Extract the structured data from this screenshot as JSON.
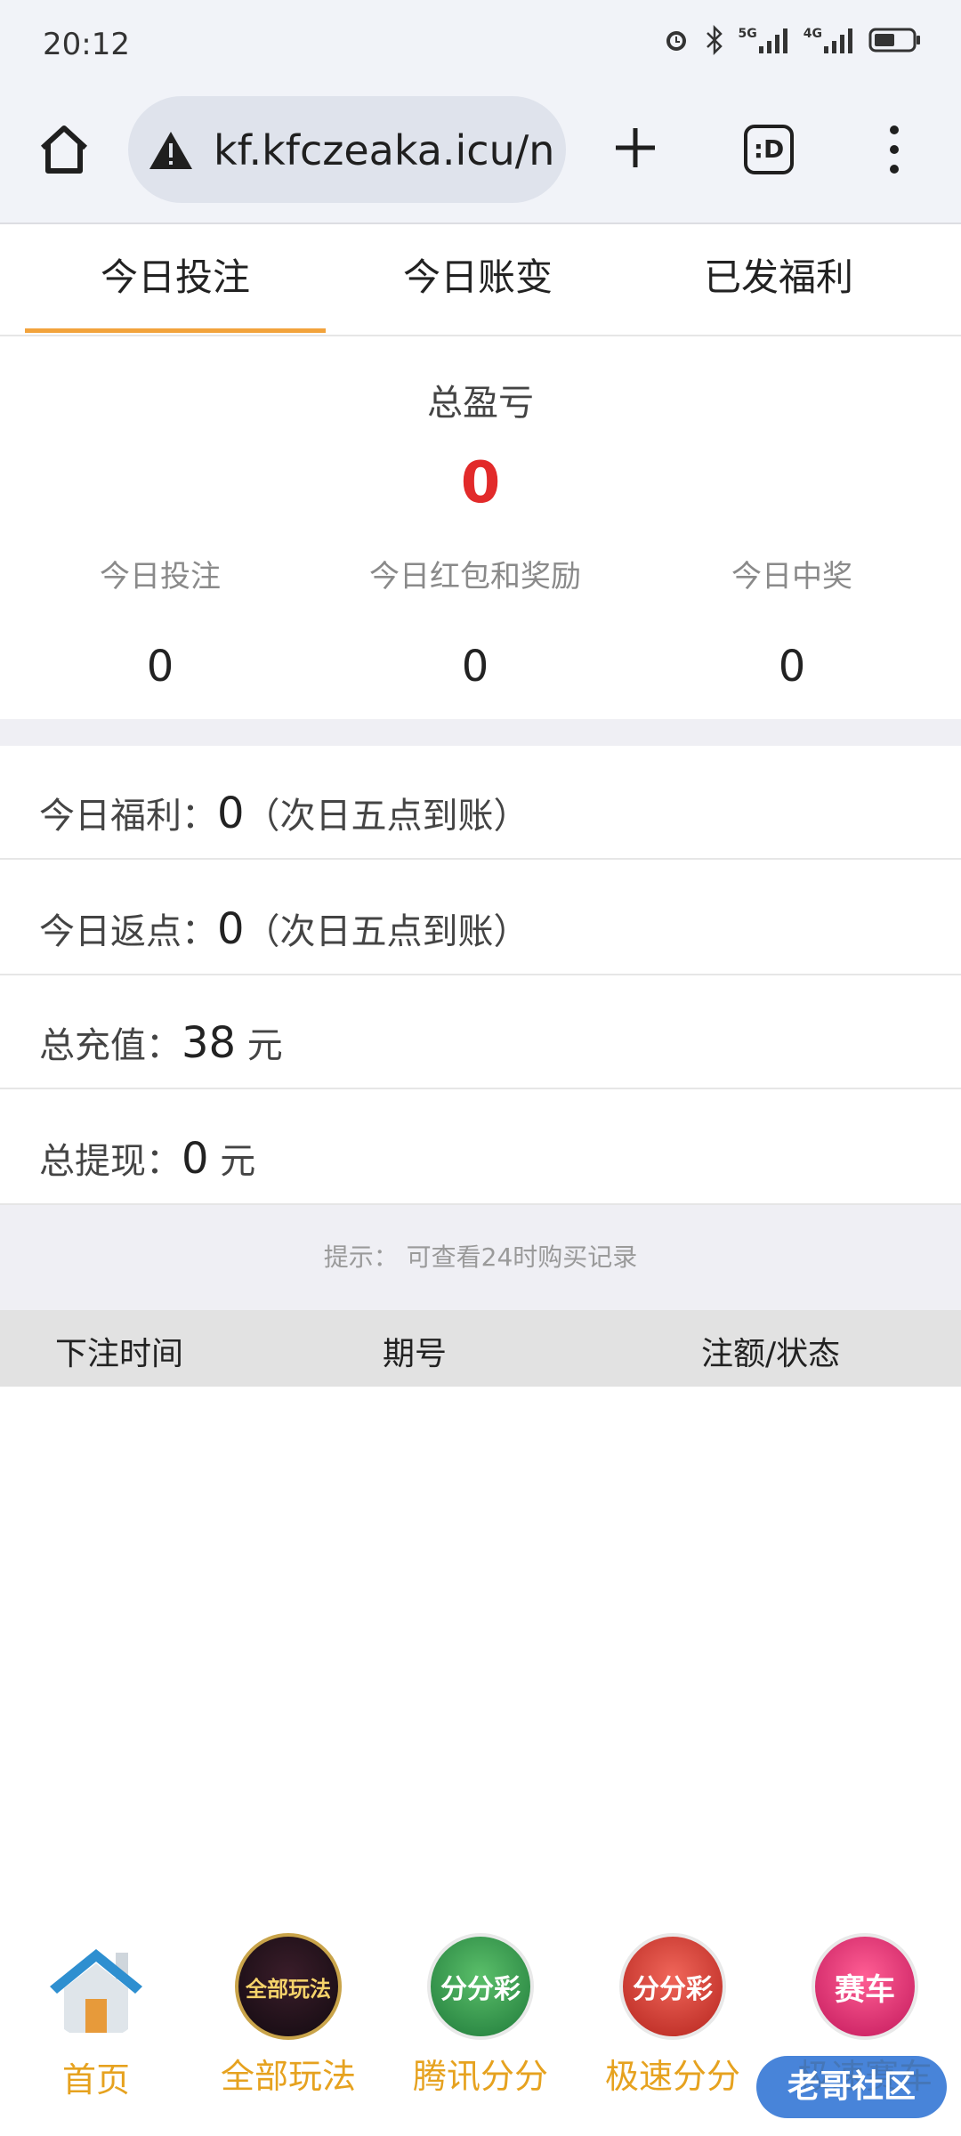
{
  "status_bar": {
    "time": "20:12",
    "icons": [
      "alarm-icon",
      "bluetooth-icon",
      "signal-5g-icon",
      "signal-4g-icon",
      "battery-icon"
    ],
    "net1": "5G",
    "net2": "4G"
  },
  "browser": {
    "url": "kf.kfczeaka.icu/n",
    "tabs_label": ":D"
  },
  "tabs": [
    {
      "label": "今日投注",
      "active": true
    },
    {
      "label": "今日账变",
      "active": false
    },
    {
      "label": "已发福利",
      "active": false
    }
  ],
  "summary": {
    "title": "总盈亏",
    "total": "0",
    "stats": [
      {
        "label": "今日投注",
        "value": "0"
      },
      {
        "label": "今日红包和奖励",
        "value": "0"
      },
      {
        "label": "今日中奖",
        "value": "0"
      }
    ]
  },
  "rows": [
    {
      "label": "今日福利：",
      "value": "0",
      "suffix": "（次日五点到账）"
    },
    {
      "label": "今日返点：",
      "value": "0",
      "suffix": "（次日五点到账）"
    },
    {
      "label": "总充值：",
      "value": "38",
      "suffix": " 元"
    },
    {
      "label": "总提现：",
      "value": "0",
      "suffix": " 元"
    }
  ],
  "hint": "提示： 可查看24时购买记录",
  "table_headers": [
    "下注时间",
    "期号",
    "注额/状态"
  ],
  "bottom_nav": [
    {
      "label": "首页",
      "icon": "home-house-icon"
    },
    {
      "label": "全部玩法",
      "icon": "all-games-icon",
      "badge": "全部玩法"
    },
    {
      "label": "腾讯分分",
      "icon": "tencent-ffc-icon",
      "badge": "分分彩"
    },
    {
      "label": "极速分分",
      "icon": "speed-ffc-icon",
      "badge": "分分彩"
    },
    {
      "label": "极速赛车",
      "icon": "speed-racing-icon",
      "badge": "赛车"
    }
  ],
  "watermark": "老哥社区",
  "colors": {
    "accent": "#f2a33c",
    "total": "#e22a2a",
    "nav_label": "#e6a21f"
  }
}
